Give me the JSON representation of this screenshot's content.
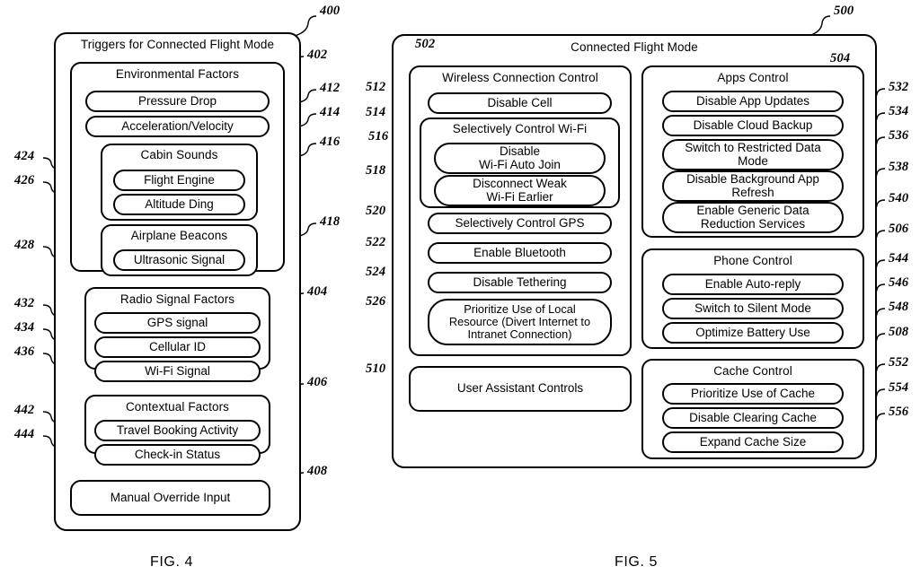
{
  "figures": [
    {
      "id": "fig4",
      "caption": "FIG. 4",
      "ref": "400",
      "title": "Triggers for Connected Flight Mode",
      "groups": [
        {
          "ref": "402",
          "title": "Environmental Factors",
          "items": [
            {
              "ref": "412",
              "label": "Pressure Drop"
            },
            {
              "ref": "414",
              "label": "Acceleration/Velocity"
            }
          ],
          "subgroups": [
            {
              "ref": "416",
              "title": "Cabin Sounds",
              "items": [
                {
                  "ref": "424",
                  "label": "Flight Engine"
                },
                {
                  "ref": "426",
                  "label": "Altitude Ding"
                }
              ]
            },
            {
              "ref": "418",
              "title": "Airplane Beacons",
              "items": [
                {
                  "ref": "428",
                  "label": "Ultrasonic Signal"
                }
              ]
            }
          ]
        },
        {
          "ref": "404",
          "title": "Radio Signal Factors",
          "items": [
            {
              "ref": "432",
              "label": "GPS signal"
            },
            {
              "ref": "434",
              "label": "Cellular ID"
            },
            {
              "ref": "436",
              "label": "Wi-Fi Signal"
            }
          ],
          "subgroups": []
        },
        {
          "ref": "406",
          "title": "Contextual Factors",
          "items": [
            {
              "ref": "442",
              "label": "Travel Booking Activity"
            },
            {
              "ref": "444",
              "label": "Check-in Status"
            }
          ],
          "subgroups": []
        }
      ],
      "standalone": [
        {
          "ref": "408",
          "label": "Manual Override Input"
        }
      ]
    },
    {
      "id": "fig5",
      "caption": "FIG. 5",
      "ref": "500",
      "title": "Connected Flight Mode",
      "groups": [
        {
          "ref": "502",
          "title": "Wireless Connection Control",
          "items": [
            {
              "ref": "512",
              "label": "Disable Cell"
            },
            {
              "ref": "520",
              "label": "Selectively Control GPS"
            },
            {
              "ref": "522",
              "label": "Enable Bluetooth"
            },
            {
              "ref": "524",
              "label": "Disable Tethering"
            },
            {
              "ref": "526",
              "label": "Prioritize Use of Local Resource (Divert Internet to Intranet Connection)"
            }
          ],
          "subgroups": [
            {
              "ref": "514",
              "title": "Selectively Control Wi-Fi",
              "items": [
                {
                  "ref": "516",
                  "label": "Disable Wi-Fi Auto Join"
                },
                {
                  "ref": "518",
                  "label": "Disconnect Weak Wi-Fi Earlier"
                }
              ]
            }
          ]
        },
        {
          "ref": "504",
          "title": "Apps Control",
          "items": [
            {
              "ref": "532",
              "label": "Disable App Updates"
            },
            {
              "ref": "534",
              "label": "Disable Cloud Backup"
            },
            {
              "ref": "536",
              "label": "Switch to Restricted Data Mode"
            },
            {
              "ref": "538",
              "label": "Disable Background App Refresh"
            },
            {
              "ref": "540",
              "label": "Enable Generic Data Reduction Services"
            }
          ],
          "subgroups": []
        },
        {
          "ref": "506",
          "title": "Phone Control",
          "items": [
            {
              "ref": "544",
              "label": "Enable Auto-reply"
            },
            {
              "ref": "546",
              "label": "Switch to Silent Mode"
            },
            {
              "ref": "548",
              "label": "Optimize Battery Use"
            }
          ],
          "subgroups": []
        },
        {
          "ref": "508",
          "title": "Cache Control",
          "items": [
            {
              "ref": "552",
              "label": "Prioritize Use of Cache"
            },
            {
              "ref": "554",
              "label": "Disable Clearing Cache"
            },
            {
              "ref": "556",
              "label": "Expand Cache Size"
            }
          ],
          "subgroups": []
        }
      ],
      "standalone": [
        {
          "ref": "510",
          "label": "User Assistant Controls"
        }
      ]
    }
  ],
  "labels": {
    "fig4": {
      "caption": "FIG. 4",
      "ref_400": "400",
      "title": "Triggers for Connected Flight Mode",
      "ref_402": "402",
      "env_title": "Environmental Factors",
      "ref_412": "412",
      "pressure_drop": "Pressure Drop",
      "ref_414": "414",
      "acceleration": "Acceleration/Velocity",
      "ref_416": "416",
      "cabin_sounds": "Cabin Sounds",
      "ref_424": "424",
      "flight_engine": "Flight Engine",
      "ref_426": "426",
      "altitude_ding": "Altitude Ding",
      "ref_418": "418",
      "airplane_beacons": "Airplane Beacons",
      "ref_428": "428",
      "ultrasonic_signal": "Ultrasonic Signal",
      "ref_404": "404",
      "radio_title": "Radio Signal Factors",
      "ref_432": "432",
      "gps_signal": "GPS signal",
      "ref_434": "434",
      "cellular_id": "Cellular ID",
      "ref_436": "436",
      "wifi_signal": "Wi-Fi Signal",
      "ref_406": "406",
      "ctx_title": "Contextual Factors",
      "ref_442": "442",
      "travel_booking": "Travel Booking Activity",
      "ref_444": "444",
      "checkin_status": "Check-in Status",
      "ref_408": "408",
      "manual_override": "Manual Override Input"
    },
    "fig5": {
      "caption": "FIG. 5",
      "ref_500": "500",
      "title": "Connected Flight Mode",
      "ref_502": "502",
      "wcc_title": "Wireless Connection Control",
      "ref_512": "512",
      "disable_cell": "Disable Cell",
      "ref_514": "514",
      "sel_wifi_title": "Selectively Control Wi-Fi",
      "ref_516": "516",
      "disable_autojoin_1": "Disable",
      "disable_autojoin_2": "Wi-Fi Auto Join",
      "ref_518": "518",
      "disconnect_weak_1": "Disconnect Weak",
      "disconnect_weak_2": "Wi-Fi Earlier",
      "ref_520": "520",
      "sel_gps": "Selectively Control GPS",
      "ref_522": "522",
      "enable_bluetooth": "Enable Bluetooth",
      "ref_524": "524",
      "disable_tethering": "Disable Tethering",
      "ref_526": "526",
      "prioritize_local_1": "Prioritize Use of Local",
      "prioritize_local_2": "Resource (Divert Internet to",
      "prioritize_local_3": "Intranet Connection)",
      "ref_510": "510",
      "user_assistant": "User Assistant Controls",
      "ref_504": "504",
      "apps_title": "Apps Control",
      "ref_532": "532",
      "disable_app_updates": "Disable App Updates",
      "ref_534": "534",
      "disable_cloud_backup": "Disable Cloud Backup",
      "ref_536": "536",
      "restricted_data_1": "Switch to Restricted Data",
      "restricted_data_2": "Mode",
      "ref_538": "538",
      "bg_refresh_1": "Disable Background App",
      "bg_refresh_2": "Refresh",
      "ref_540": "540",
      "data_reduction_1": "Enable Generic Data",
      "data_reduction_2": "Reduction Services",
      "ref_506": "506",
      "phone_title": "Phone Control",
      "ref_544": "544",
      "auto_reply": "Enable Auto-reply",
      "ref_546": "546",
      "silent_mode": "Switch to Silent Mode",
      "ref_548": "548",
      "battery_use": "Optimize Battery Use",
      "ref_508": "508",
      "cache_title": "Cache Control",
      "ref_552": "552",
      "prioritize_cache": "Prioritize Use of Cache",
      "ref_554": "554",
      "disable_clearing": "Disable Clearing Cache",
      "ref_556": "556",
      "expand_cache": "Expand Cache Size"
    }
  }
}
